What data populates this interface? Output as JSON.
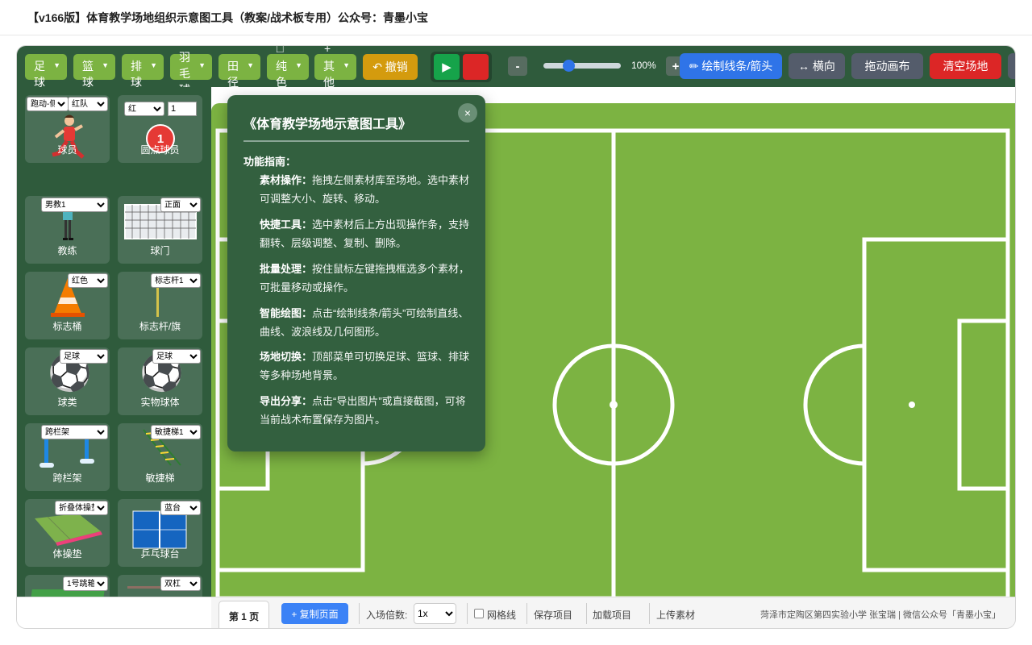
{
  "page": {
    "title": "【v166版】体育教学场地组织示意图工具（教案/战术板专用）公众号：青墨小宝"
  },
  "toolbar": {
    "sports": [
      {
        "glyph": "",
        "label": "足球"
      },
      {
        "glyph": "",
        "label": "篮球"
      },
      {
        "glyph": "",
        "label": "排球"
      },
      {
        "glyph": "",
        "label": "羽毛球"
      },
      {
        "glyph": "",
        "label": "田径"
      },
      {
        "glyph": "□",
        "label": "纯色"
      },
      {
        "glyph": "+",
        "label": "其他"
      }
    ],
    "caret": "▼",
    "undo_label": "↶ 撤销",
    "play_glyph": "▶",
    "stop_glyph": "",
    "zoom_minus": "-",
    "zoom_icon": "",
    "zoom_level": "100%",
    "zoom_fraction": 0.3,
    "zoom_plus": "+",
    "draw_label": "✏ 绘制线条/箭头",
    "orientation_label": "↔ 横向",
    "drag_label": " 拖动画布",
    "clear_label": " 清空场地",
    "colors": {
      "sport_btn": "#7cb342",
      "undo": "#d49b0e",
      "draw": "#2f74e8",
      "clear": "#dc2626",
      "neutral": "#545c6b"
    }
  },
  "sidebar": {
    "tiles": [
      {
        "label": "球员",
        "selects": [
          "跑动-侧",
          "红队"
        ]
      },
      {
        "label": "圆点球员",
        "selects": [
          "红"
        ],
        "number": "1",
        "badge": "1"
      },
      {
        "label": "教练",
        "selects": [
          "男教1"
        ]
      },
      {
        "label": "球门",
        "selects": [
          "正面"
        ]
      },
      {
        "label": "标志桶",
        "selects": [
          "红色"
        ]
      },
      {
        "label": "标志杆/旗",
        "selects": [
          "标志杆1"
        ]
      },
      {
        "label": "球类",
        "selects": [
          "足球"
        ]
      },
      {
        "label": "实物球体",
        "selects": [
          "足球"
        ]
      },
      {
        "label": "跨栏架",
        "selects": [
          "跨栏架"
        ]
      },
      {
        "label": "敏捷梯",
        "selects": [
          "敏捷梯1"
        ]
      },
      {
        "label": "体操垫",
        "selects": [
          "折叠体操垫"
        ]
      },
      {
        "label": "乒乓球台",
        "selects": [
          "蓝台"
        ]
      },
      {
        "label": "",
        "selects": [
          "1号跳箱"
        ]
      },
      {
        "label": "",
        "selects": [
          "双杠"
        ]
      }
    ]
  },
  "modal": {
    "title": "《体育教学场地示意图工具》",
    "close": "×",
    "guide_title": "功能指南：",
    "items": [
      {
        "head": "素材操作：",
        "body": "拖拽左侧素材库至场地。选中素材可调整大小、旋转、移动。"
      },
      {
        "head": "快捷工具：",
        "body": "选中素材后上方出现操作条，支持翻转、层级调整、复制、删除。"
      },
      {
        "head": "批量处理：",
        "body": "按住鼠标左键拖拽框选多个素材，可批量移动或操作。"
      },
      {
        "head": "智能绘图：",
        "body": "点击“绘制线条/箭头”可绘制直线、曲线、波浪线及几何图形。"
      },
      {
        "head": "场地切换：",
        "body": "顶部菜单可切换足球、篮球、排球等多种场地背景。"
      },
      {
        "head": "导出分享：",
        "body": "点击“导出图片”或直接截图，可将当前战术布置保存为图片。"
      }
    ]
  },
  "bottombar": {
    "page_tab": "第 1 页",
    "copy_page": "+ 复制页面",
    "speed_label": "入场倍数:",
    "speed_value": "1x",
    "grid_label": "网格线",
    "save_label": " 保存项目",
    "load_label": " 加载项目",
    "upload_label": " 上传素材",
    "credit": "菏泽市定陶区第四实验小学 张宝瑞 | 微信公众号「青墨小宝」"
  }
}
